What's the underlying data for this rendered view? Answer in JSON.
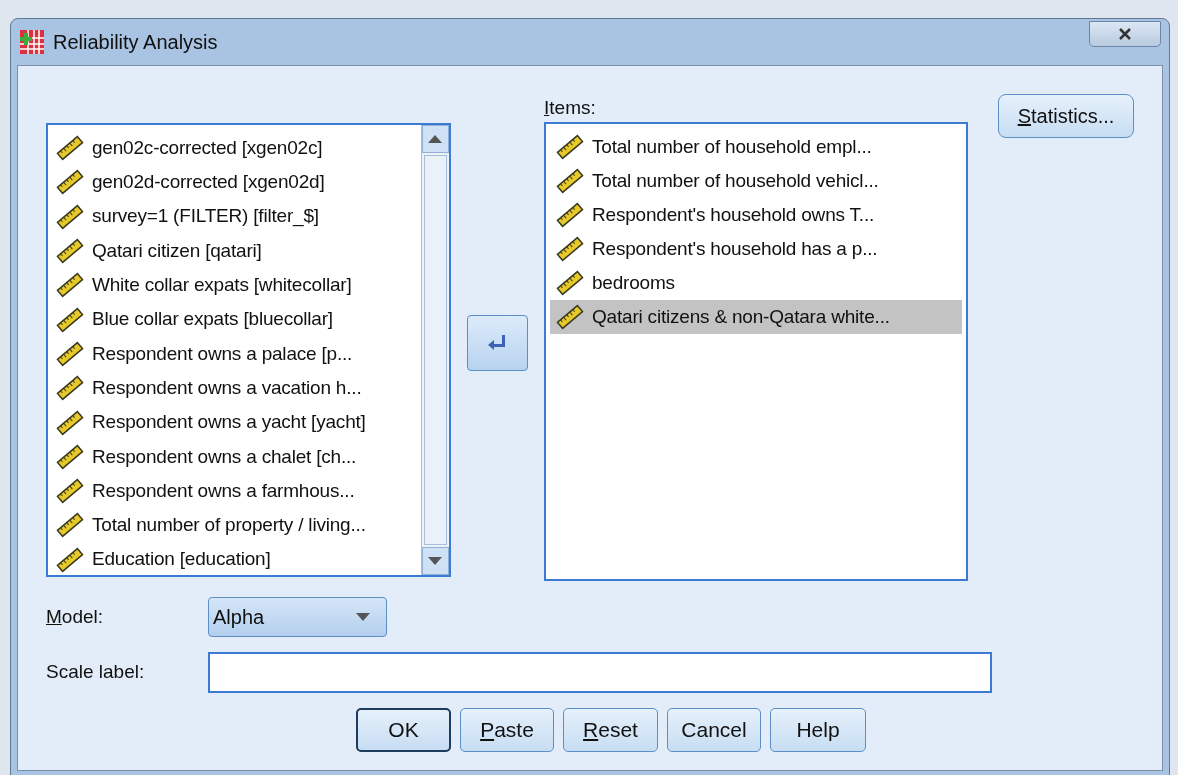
{
  "window": {
    "title": "Reliability Analysis"
  },
  "variables": [
    {
      "label": "gen02c-corrected [xgen02c]"
    },
    {
      "label": "gen02d-corrected [xgen02d]"
    },
    {
      "label": "survey=1 (FILTER) [filter_$]"
    },
    {
      "label": "Qatari citizen [qatari]"
    },
    {
      "label": "White collar expats [whitecollar]"
    },
    {
      "label": "Blue collar expats [bluecollar]"
    },
    {
      "label": "Respondent owns a palace [p..."
    },
    {
      "label": "Respondent owns a vacation h..."
    },
    {
      "label": "Respondent owns a yacht [yacht]"
    },
    {
      "label": "Respondent owns a chalet [ch..."
    },
    {
      "label": "Respondent owns a farmhous..."
    },
    {
      "label": "Total number of property / living..."
    },
    {
      "label": "Education [education]"
    }
  ],
  "items": {
    "label": "Items:",
    "mnemonic": true,
    "rows": [
      {
        "label": "Total number of household empl...",
        "selected": false
      },
      {
        "label": "Total number of household vehicl...",
        "selected": false
      },
      {
        "label": "Respondent's household owns T...",
        "selected": false
      },
      {
        "label": "Respondent's household has a p...",
        "selected": false
      },
      {
        "label": "bedrooms",
        "selected": false
      },
      {
        "label": "Qatari citizens & non-Qatara white...",
        "selected": true
      }
    ]
  },
  "statistics_button": {
    "label": "Statistics...",
    "mnemonic": true
  },
  "model": {
    "label": "Model:",
    "mnemonic": true,
    "value": "Alpha"
  },
  "scale_label": {
    "label": "Scale label:",
    "mnemonic": false
  },
  "buttons": [
    {
      "label": "OK",
      "mnemonic": false,
      "default": true
    },
    {
      "label": "Paste",
      "mnemonic": true,
      "default": false
    },
    {
      "label": "Reset",
      "mnemonic": true,
      "default": false
    },
    {
      "label": "Cancel",
      "mnemonic": false,
      "default": false
    },
    {
      "label": "Help",
      "mnemonic": false,
      "default": false
    }
  ]
}
